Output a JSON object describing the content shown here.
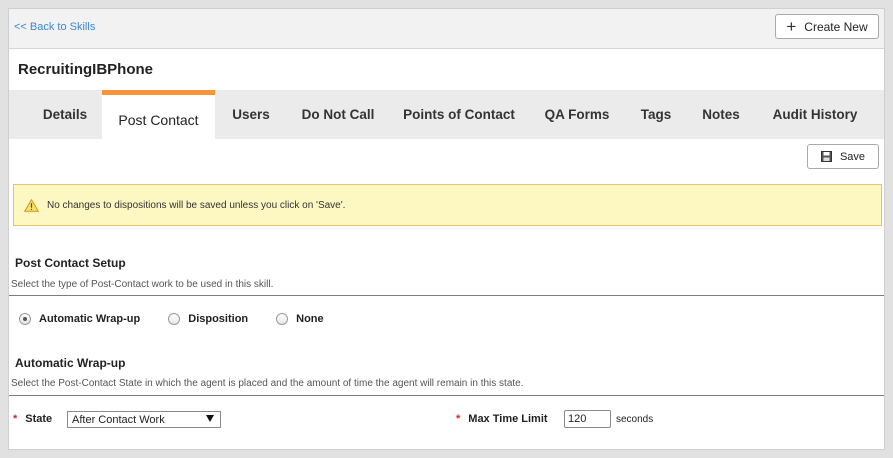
{
  "topbar": {
    "back_label": "<< Back to Skills",
    "create_label": "Create New"
  },
  "skill_title": "RecruitingIBPhone",
  "tabs": [
    {
      "label": "Details"
    },
    {
      "label": "Post Contact",
      "active": true
    },
    {
      "label": "Users"
    },
    {
      "label": "Do Not Call"
    },
    {
      "label": "Points of Contact"
    },
    {
      "label": "QA Forms"
    },
    {
      "label": "Tags"
    },
    {
      "label": "Notes"
    },
    {
      "label": "Audit History"
    }
  ],
  "save_label": "Save",
  "warning_text": "No changes to dispositions will be saved unless you click on 'Save'.",
  "post_contact_setup": {
    "title": "Post Contact Setup",
    "description": "Select the type of Post-Contact work to be used in this skill.",
    "options": [
      {
        "label": "Automatic Wrap-up",
        "checked": true
      },
      {
        "label": "Disposition",
        "checked": false
      },
      {
        "label": "None",
        "checked": false
      }
    ]
  },
  "automatic_wrapup": {
    "title": "Automatic Wrap-up",
    "description": "Select the Post-Contact State in which the agent is placed and the amount of time the agent will remain in this state.",
    "required_mark": "*",
    "state_label": "State",
    "state_value": "After Contact Work",
    "max_time_label": "Max Time Limit",
    "max_time_value": "120",
    "max_time_unit": "seconds"
  },
  "colors": {
    "accent_tab": "#f7943a",
    "link": "#3a87d6",
    "warning_bg": "#fdf7c2",
    "required": "#d9262b"
  },
  "icons": {
    "create": "plus-icon",
    "save": "floppy-disk-icon",
    "warning": "warning-triangle-icon",
    "dropdown": "dropdown-arrow-icon"
  }
}
